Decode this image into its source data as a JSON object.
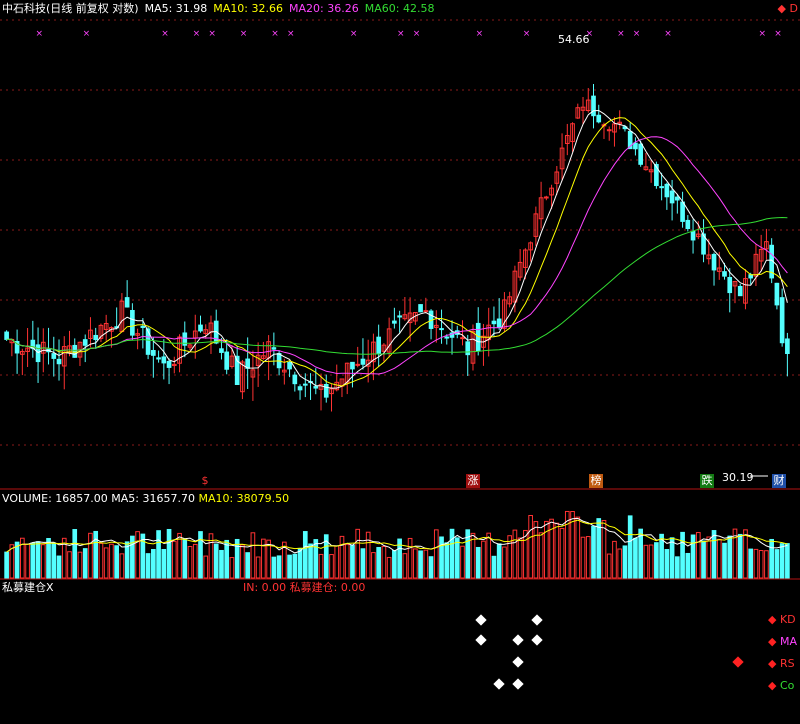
{
  "header": {
    "title": "中石科技(日线 前复权 对数)",
    "ma5": "MA5: 31.98",
    "ma10": "MA10: 32.66",
    "ma20": "MA20: 36.26",
    "ma60": "MA60: 42.58",
    "right_marker": "D"
  },
  "annotations": {
    "high_label": "54.66",
    "low_label": "30.19",
    "tag_dollar": "$",
    "tag_zhang": "涨",
    "tag_bang": "榜",
    "tag_die": "跌",
    "tag_cai": "财"
  },
  "volume_header": {
    "volume": "VOLUME: 16857.00",
    "ma5": "MA5: 31657.70",
    "ma10": "MA10: 38079.50"
  },
  "indicator": {
    "name": "私募建仓",
    "close_mark": "X",
    "values": "IN: 0.00  私募建仓: 0.00",
    "legend": [
      {
        "label": "KD",
        "color": "#ff3333"
      },
      {
        "label": "MA",
        "color": "#ff44ff"
      },
      {
        "label": "RS",
        "color": "#ff3333"
      },
      {
        "label": "Co",
        "color": "#33dd33"
      }
    ]
  },
  "colors": {
    "up": "#ff3333",
    "down": "#54ffff",
    "ma5": "#ffffff",
    "ma10": "#ffff00",
    "ma20": "#ff44ff",
    "ma60": "#33dd33",
    "grid": "#8a1a1a"
  },
  "chart_data": {
    "type": "candlestick",
    "title": "中石科技(日线 前复权 对数)",
    "ohlc_approx": {
      "start_price": 34.5,
      "high": 54.66,
      "low": 30.19,
      "last_close": 31.98
    },
    "moving_averages": [
      {
        "name": "MA5",
        "value": 31.98
      },
      {
        "name": "MA10",
        "value": 32.66
      },
      {
        "name": "MA20",
        "value": 36.26
      },
      {
        "name": "MA60",
        "value": 42.58
      }
    ],
    "volume": {
      "last": 16857.0,
      "ma5": 31657.7,
      "ma10": 38079.5
    },
    "indicator": {
      "IN": 0.0,
      "私募建仓": 0.0
    }
  }
}
